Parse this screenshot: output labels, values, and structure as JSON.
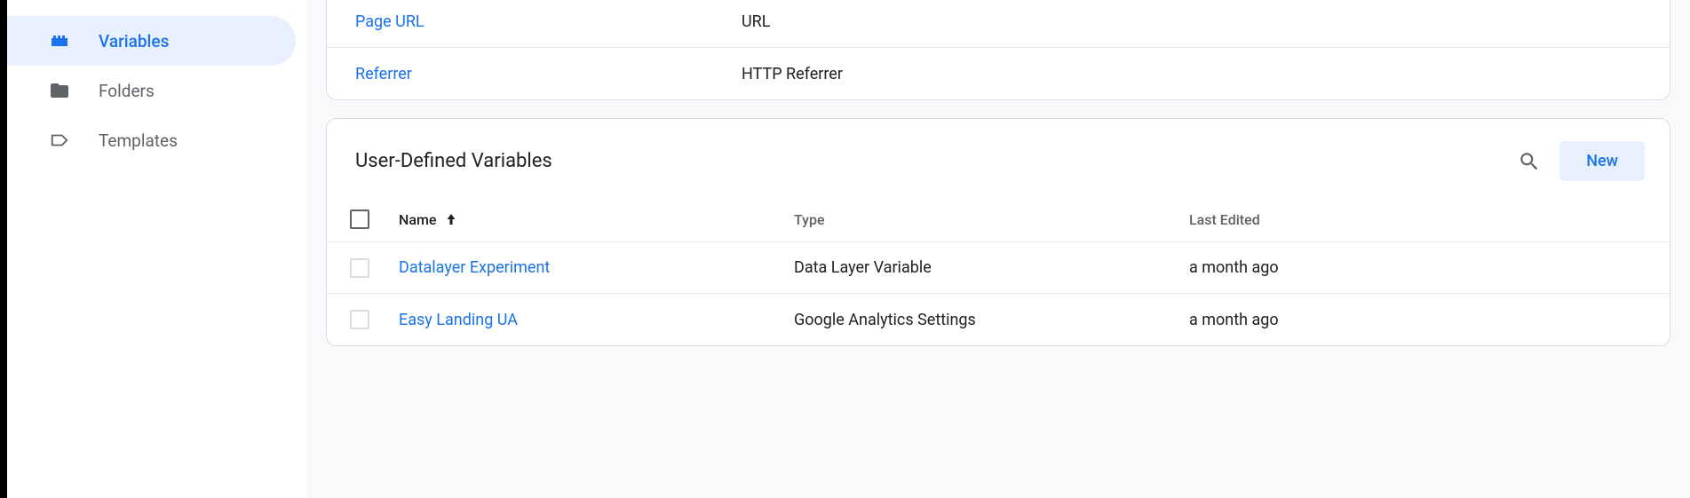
{
  "sidebar": {
    "items": [
      {
        "label": "Variables",
        "icon": "variables-icon",
        "active": true
      },
      {
        "label": "Folders",
        "icon": "folder-icon",
        "active": false
      },
      {
        "label": "Templates",
        "icon": "template-icon",
        "active": false
      }
    ]
  },
  "builtIn": {
    "rows": [
      {
        "name": "Page URL",
        "type": "URL"
      },
      {
        "name": "Referrer",
        "type": "HTTP Referrer"
      }
    ]
  },
  "userDefined": {
    "title": "User-Defined Variables",
    "newLabel": "New",
    "columns": {
      "name": "Name",
      "type": "Type",
      "edited": "Last Edited"
    },
    "rows": [
      {
        "name": "Datalayer Experiment",
        "type": "Data Layer Variable",
        "edited": "a month ago"
      },
      {
        "name": "Easy Landing UA",
        "type": "Google Analytics Settings",
        "edited": "a month ago"
      }
    ]
  }
}
